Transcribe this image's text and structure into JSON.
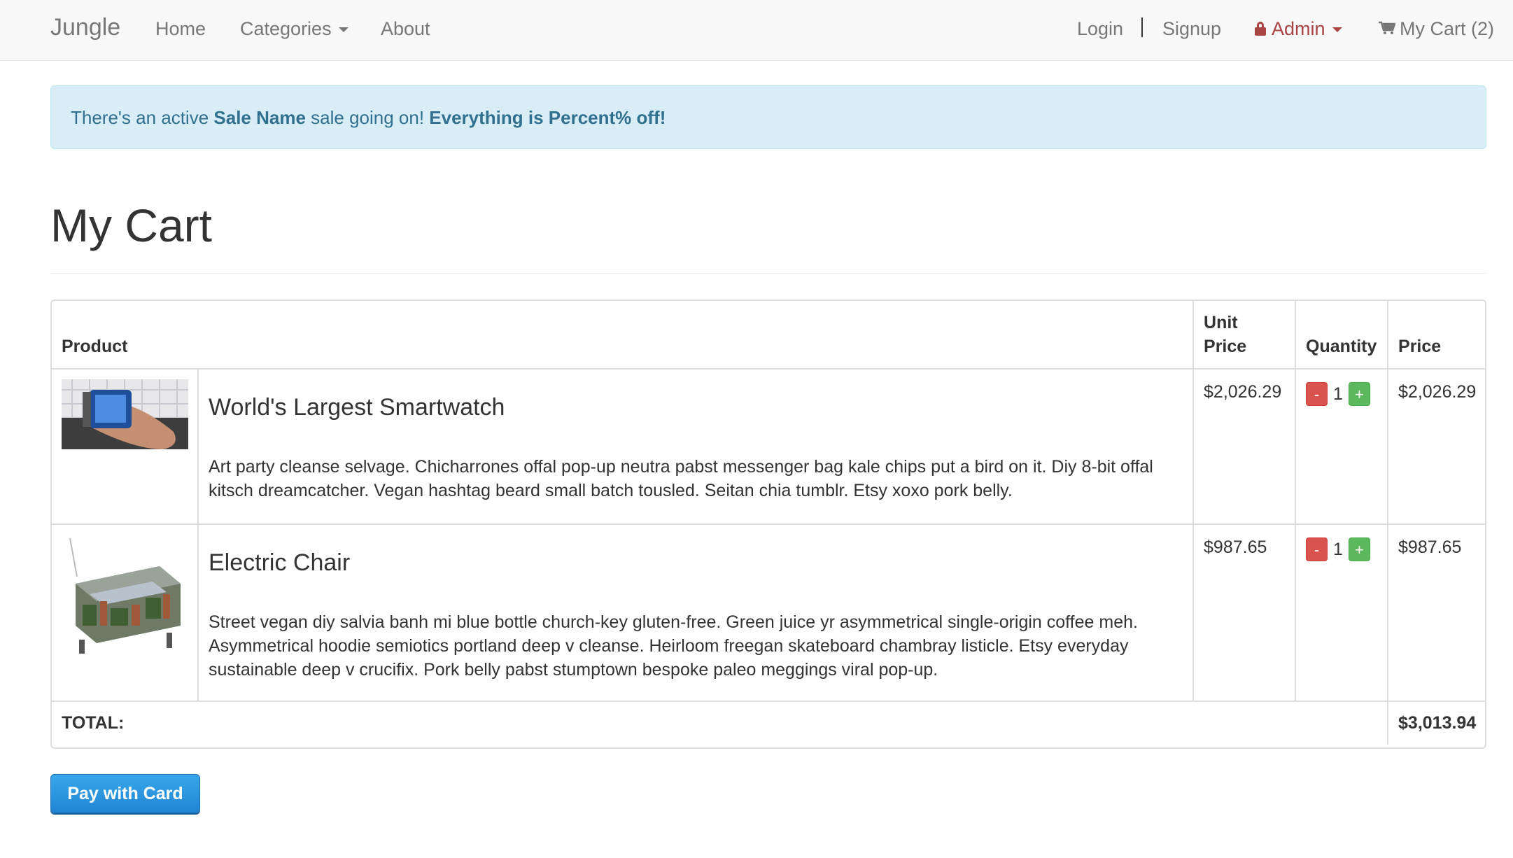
{
  "navbar": {
    "brand": "Jungle",
    "home": "Home",
    "categories": "Categories",
    "about": "About",
    "login": "Login",
    "separator": "|",
    "signup": "Signup",
    "admin": "Admin",
    "cart": "My Cart (2)"
  },
  "alert": {
    "prefix": "There's an active ",
    "sale_name": "Sale Name",
    "middle": " sale going on! ",
    "offer": "Everything is Percent% off!"
  },
  "page_title": "My Cart",
  "table": {
    "headers": {
      "product": "Product",
      "unit_price_line1": "Unit",
      "unit_price_line2": "Price",
      "quantity": "Quantity",
      "price": "Price"
    },
    "items": [
      {
        "name": "World's Largest Smartwatch",
        "description": "Art party cleanse selvage. Chicharrones offal pop-up neutra pabst messenger bag kale chips put a bird on it. Diy 8-bit offal kitsch dreamcatcher. Vegan hashtag beard small batch tousled. Seitan chia tumblr. Etsy xoxo pork belly.",
        "unit_price": "$2,026.29",
        "quantity": "1",
        "price": "$2,026.29",
        "minus": "-",
        "plus": "+"
      },
      {
        "name": "Electric Chair",
        "description": "Street vegan diy salvia banh mi blue bottle church-key gluten-free. Green juice yr asymmetrical single-origin coffee meh. Asymmetrical hoodie semiotics portland deep v cleanse. Heirloom freegan skateboard chambray listicle. Etsy everyday sustainable deep v crucifix. Pork belly pabst stumptown bespoke paleo meggings viral pop-up.",
        "unit_price": "$987.65",
        "quantity": "1",
        "price": "$987.65",
        "minus": "-",
        "plus": "+"
      }
    ],
    "total_label": "TOTAL:",
    "total_value": "$3,013.94"
  },
  "pay_button": "Pay with Card",
  "colors": {
    "alert_bg": "#d9edf7",
    "alert_text": "#31708f",
    "admin": "#a94442",
    "minus_btn": "#d9534f",
    "plus_btn": "#5cb85c",
    "pay_btn": "#2a8fdc"
  }
}
